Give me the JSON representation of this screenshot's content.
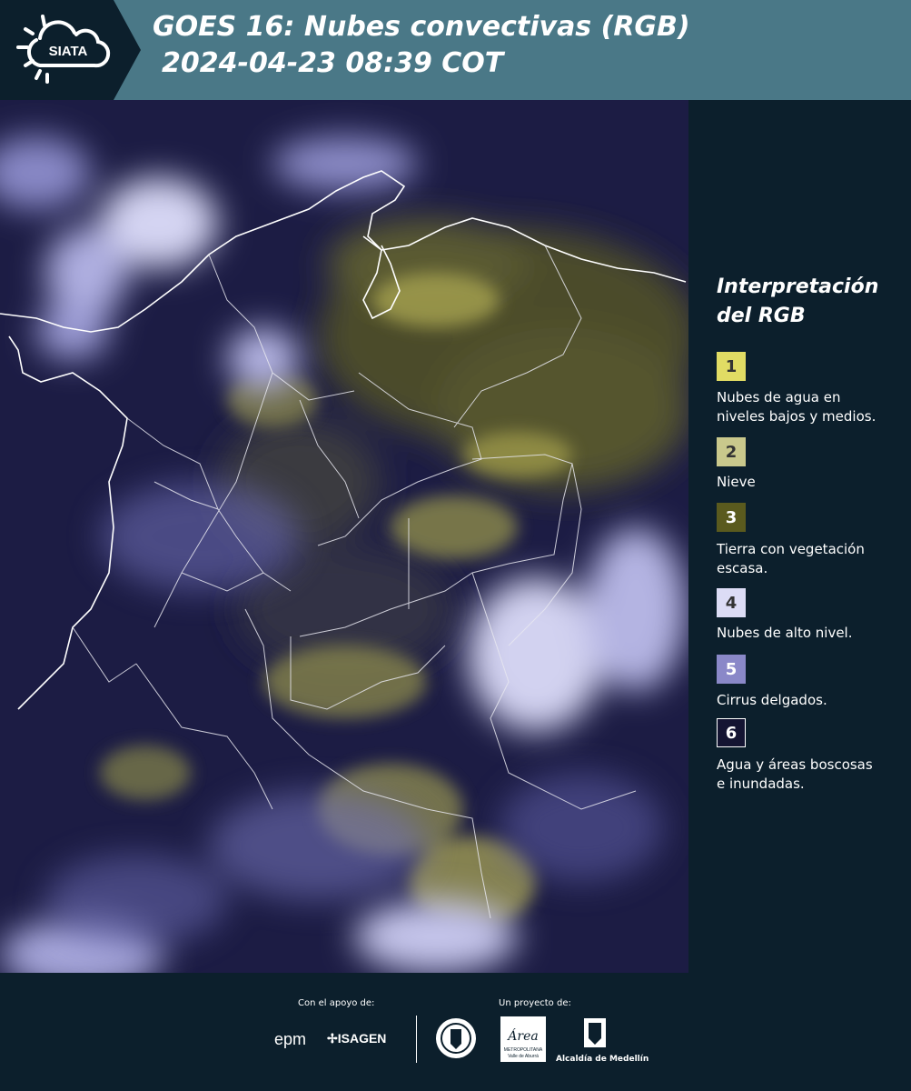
{
  "header": {
    "logo_text": "SIATA",
    "title_line1": "GOES 16: Nubes convectivas (RGB)",
    "title_line2": "2024-04-23 08:39 COT"
  },
  "legend": {
    "title_line1": "Interpretación",
    "title_line2": "del RGB",
    "items": [
      {
        "number": "1",
        "label_line1": "Nubes de agua en",
        "label_line2": "niveles bajos y medios.",
        "color": "#e1dc64",
        "text_color": "#333333"
      },
      {
        "number": "2",
        "label_line1": "Nieve",
        "label_line2": "",
        "color": "#c9c88c",
        "text_color": "#333333"
      },
      {
        "number": "3",
        "label_line1": "Tierra con vegetación",
        "label_line2": "escasa.",
        "color": "#5a5a1e",
        "text_color": "#ffffff"
      },
      {
        "number": "4",
        "label_line1": "Nubes de alto nivel.",
        "label_line2": "",
        "color": "#dcdcf5",
        "text_color": "#333333"
      },
      {
        "number": "5",
        "label_line1": "Cirrus delgados.",
        "label_line2": "",
        "color": "#8a88c8",
        "text_color": "#ffffff"
      },
      {
        "number": "6",
        "label_line1": "Agua y áreas boscosas",
        "label_line2": "e inundadas.",
        "color": "#141432",
        "text_color": "#ffffff"
      }
    ]
  },
  "footer": {
    "support_label": "Con el apoyo de:",
    "project_label": "Un proyecto de:",
    "sponsors": [
      "epm",
      "ISAGEN"
    ],
    "partners": [
      "Área Metropolitana Valle de Aburrá",
      "Alcaldía de Medellín"
    ],
    "metro_logo_word": "Área",
    "metro_logo_line1": "METROPOLITANA",
    "metro_logo_line2": "Valle de Aburrá"
  }
}
